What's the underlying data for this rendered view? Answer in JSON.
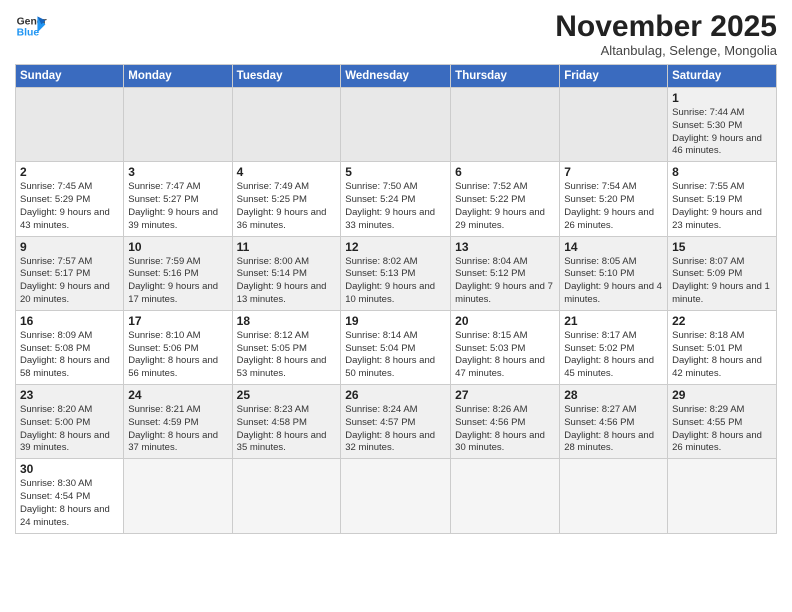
{
  "header": {
    "logo_line1": "General",
    "logo_line2": "Blue",
    "month_title": "November 2025",
    "subtitle": "Altanbulag, Selenge, Mongolia"
  },
  "weekdays": [
    "Sunday",
    "Monday",
    "Tuesday",
    "Wednesday",
    "Thursday",
    "Friday",
    "Saturday"
  ],
  "weeks": [
    [
      {
        "day": "",
        "info": ""
      },
      {
        "day": "",
        "info": ""
      },
      {
        "day": "",
        "info": ""
      },
      {
        "day": "",
        "info": ""
      },
      {
        "day": "",
        "info": ""
      },
      {
        "day": "",
        "info": ""
      },
      {
        "day": "1",
        "info": "Sunrise: 7:44 AM\nSunset: 5:30 PM\nDaylight: 9 hours\nand 46 minutes."
      }
    ],
    [
      {
        "day": "2",
        "info": "Sunrise: 7:45 AM\nSunset: 5:29 PM\nDaylight: 9 hours\nand 43 minutes."
      },
      {
        "day": "3",
        "info": "Sunrise: 7:47 AM\nSunset: 5:27 PM\nDaylight: 9 hours\nand 39 minutes."
      },
      {
        "day": "4",
        "info": "Sunrise: 7:49 AM\nSunset: 5:25 PM\nDaylight: 9 hours\nand 36 minutes."
      },
      {
        "day": "5",
        "info": "Sunrise: 7:50 AM\nSunset: 5:24 PM\nDaylight: 9 hours\nand 33 minutes."
      },
      {
        "day": "6",
        "info": "Sunrise: 7:52 AM\nSunset: 5:22 PM\nDaylight: 9 hours\nand 29 minutes."
      },
      {
        "day": "7",
        "info": "Sunrise: 7:54 AM\nSunset: 5:20 PM\nDaylight: 9 hours\nand 26 minutes."
      },
      {
        "day": "8",
        "info": "Sunrise: 7:55 AM\nSunset: 5:19 PM\nDaylight: 9 hours\nand 23 minutes."
      }
    ],
    [
      {
        "day": "9",
        "info": "Sunrise: 7:57 AM\nSunset: 5:17 PM\nDaylight: 9 hours\nand 20 minutes."
      },
      {
        "day": "10",
        "info": "Sunrise: 7:59 AM\nSunset: 5:16 PM\nDaylight: 9 hours\nand 17 minutes."
      },
      {
        "day": "11",
        "info": "Sunrise: 8:00 AM\nSunset: 5:14 PM\nDaylight: 9 hours\nand 13 minutes."
      },
      {
        "day": "12",
        "info": "Sunrise: 8:02 AM\nSunset: 5:13 PM\nDaylight: 9 hours\nand 10 minutes."
      },
      {
        "day": "13",
        "info": "Sunrise: 8:04 AM\nSunset: 5:12 PM\nDaylight: 9 hours\nand 7 minutes."
      },
      {
        "day": "14",
        "info": "Sunrise: 8:05 AM\nSunset: 5:10 PM\nDaylight: 9 hours\nand 4 minutes."
      },
      {
        "day": "15",
        "info": "Sunrise: 8:07 AM\nSunset: 5:09 PM\nDaylight: 9 hours\nand 1 minute."
      }
    ],
    [
      {
        "day": "16",
        "info": "Sunrise: 8:09 AM\nSunset: 5:08 PM\nDaylight: 8 hours\nand 58 minutes."
      },
      {
        "day": "17",
        "info": "Sunrise: 8:10 AM\nSunset: 5:06 PM\nDaylight: 8 hours\nand 56 minutes."
      },
      {
        "day": "18",
        "info": "Sunrise: 8:12 AM\nSunset: 5:05 PM\nDaylight: 8 hours\nand 53 minutes."
      },
      {
        "day": "19",
        "info": "Sunrise: 8:14 AM\nSunset: 5:04 PM\nDaylight: 8 hours\nand 50 minutes."
      },
      {
        "day": "20",
        "info": "Sunrise: 8:15 AM\nSunset: 5:03 PM\nDaylight: 8 hours\nand 47 minutes."
      },
      {
        "day": "21",
        "info": "Sunrise: 8:17 AM\nSunset: 5:02 PM\nDaylight: 8 hours\nand 45 minutes."
      },
      {
        "day": "22",
        "info": "Sunrise: 8:18 AM\nSunset: 5:01 PM\nDaylight: 8 hours\nand 42 minutes."
      }
    ],
    [
      {
        "day": "23",
        "info": "Sunrise: 8:20 AM\nSunset: 5:00 PM\nDaylight: 8 hours\nand 39 minutes."
      },
      {
        "day": "24",
        "info": "Sunrise: 8:21 AM\nSunset: 4:59 PM\nDaylight: 8 hours\nand 37 minutes."
      },
      {
        "day": "25",
        "info": "Sunrise: 8:23 AM\nSunset: 4:58 PM\nDaylight: 8 hours\nand 35 minutes."
      },
      {
        "day": "26",
        "info": "Sunrise: 8:24 AM\nSunset: 4:57 PM\nDaylight: 8 hours\nand 32 minutes."
      },
      {
        "day": "27",
        "info": "Sunrise: 8:26 AM\nSunset: 4:56 PM\nDaylight: 8 hours\nand 30 minutes."
      },
      {
        "day": "28",
        "info": "Sunrise: 8:27 AM\nSunset: 4:56 PM\nDaylight: 8 hours\nand 28 minutes."
      },
      {
        "day": "29",
        "info": "Sunrise: 8:29 AM\nSunset: 4:55 PM\nDaylight: 8 hours\nand 26 minutes."
      }
    ],
    [
      {
        "day": "30",
        "info": "Sunrise: 8:30 AM\nSunset: 4:54 PM\nDaylight: 8 hours\nand 24 minutes."
      },
      {
        "day": "",
        "info": ""
      },
      {
        "day": "",
        "info": ""
      },
      {
        "day": "",
        "info": ""
      },
      {
        "day": "",
        "info": ""
      },
      {
        "day": "",
        "info": ""
      },
      {
        "day": "",
        "info": ""
      }
    ]
  ]
}
